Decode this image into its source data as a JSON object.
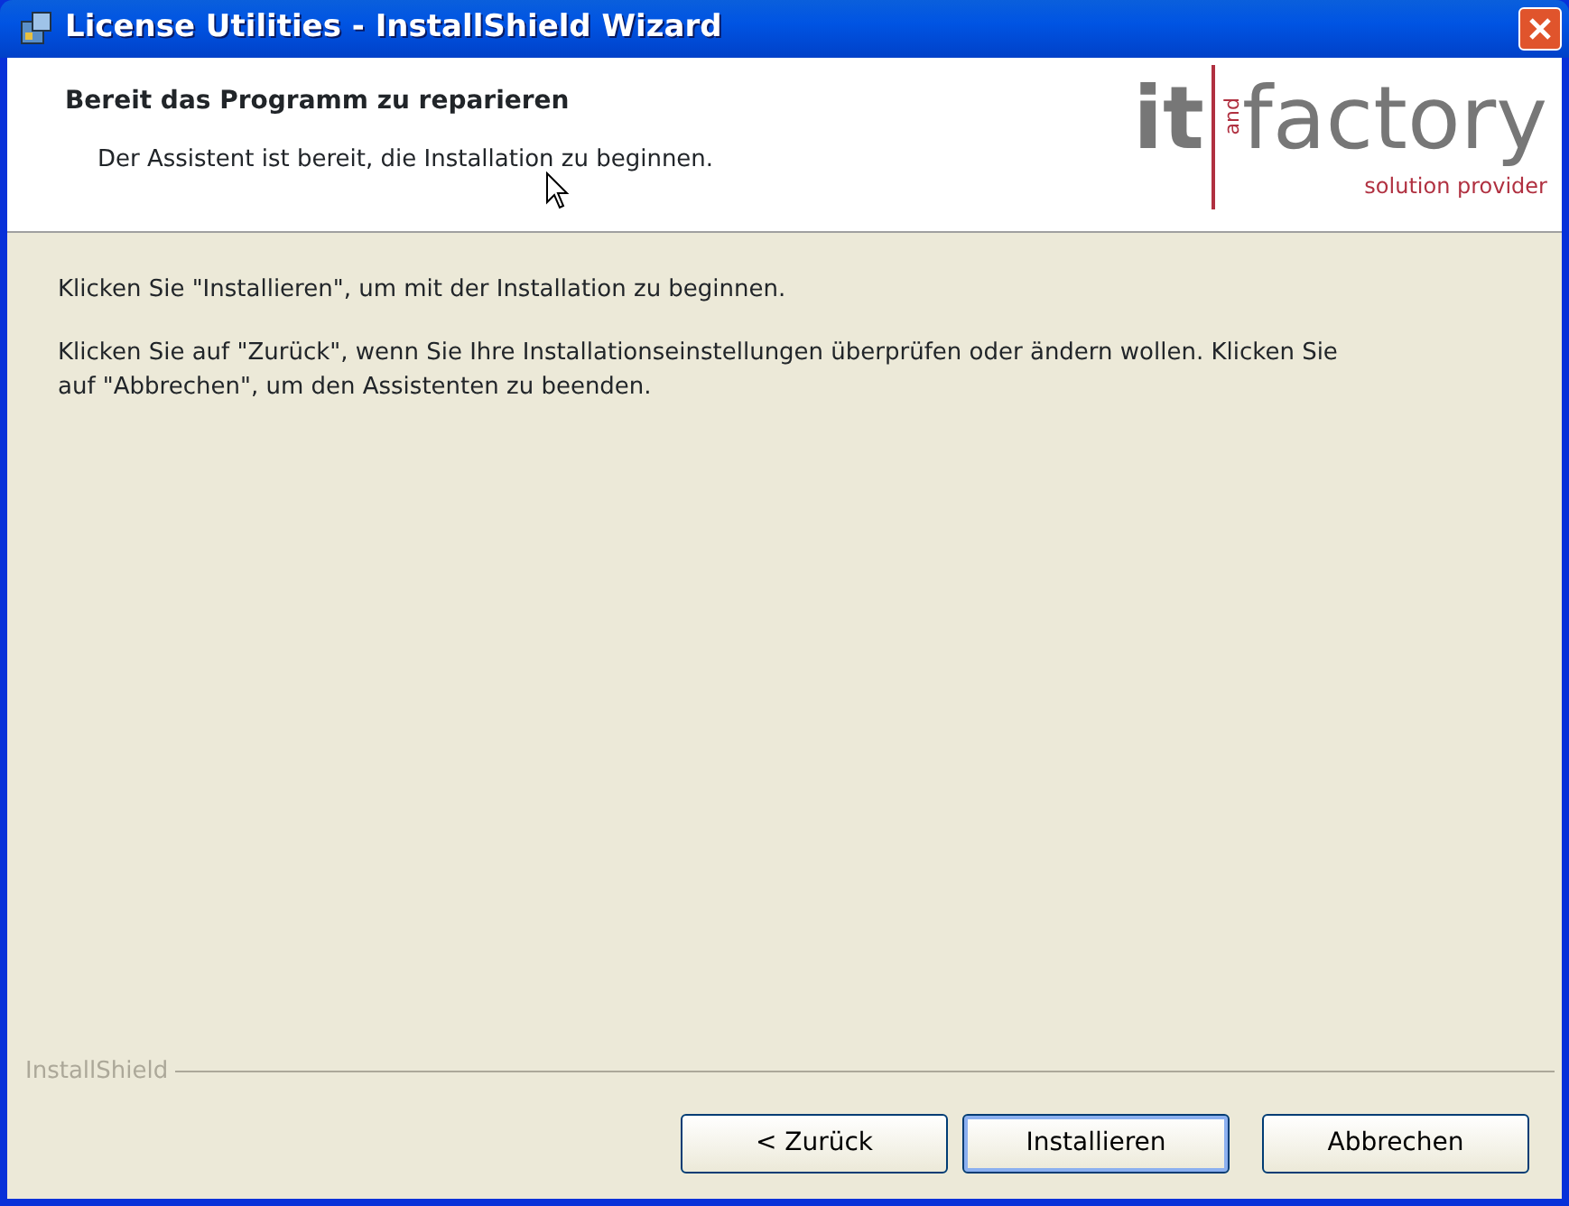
{
  "window": {
    "title": "License Utilities - InstallShield Wizard"
  },
  "header": {
    "title": "Bereit das Programm zu reparieren",
    "subtitle": "Der Assistent ist bereit, die Installation zu beginnen.",
    "logo": {
      "main_left": "it",
      "vertical": "and",
      "main_right": "factory",
      "tagline": "solution provider"
    }
  },
  "body": {
    "paragraphs": [
      "Klicken Sie \"Installieren\", um mit der Installation zu beginnen.",
      "Klicken Sie auf \"Zurück\", wenn Sie Ihre Installationseinstellungen überprüfen oder ändern wollen. Klicken Sie auf \"Abbrechen\", um den Assistenten zu beenden."
    ]
  },
  "footer": {
    "brand": "InstallShield",
    "buttons": [
      {
        "label": "< Zurück",
        "default": false
      },
      {
        "label": "Installieren",
        "default": true
      },
      {
        "label": "Abbrechen",
        "default": false
      }
    ]
  }
}
